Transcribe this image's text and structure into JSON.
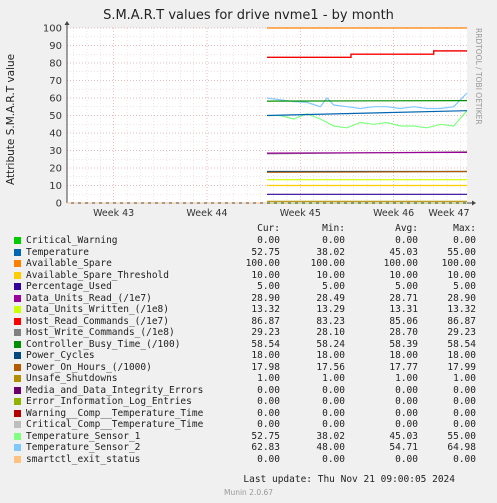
{
  "title": "S.M.A.R.T values for drive nvme1 - by month",
  "vendor_text": "RRDTOOL / TOBI OETIKER",
  "ylabel": "Attribute S.M.A.R.T value",
  "columns": [
    "Cur:",
    "Min:",
    "Avg:",
    "Max:"
  ],
  "last_update": "Last update: Thu Nov 21 09:00:05 2024",
  "munin_version": "Munin 2.0.67",
  "legend": [
    {
      "name": "Critical_Warning",
      "color": "#00cc00",
      "cur": "0.00",
      "min": "0.00",
      "avg": "0.00",
      "max": "0.00"
    },
    {
      "name": "Temperature",
      "color": "#0066b3",
      "cur": "52.75",
      "min": "38.02",
      "avg": "45.03",
      "max": "55.00"
    },
    {
      "name": "Available_Spare",
      "color": "#ff8000",
      "cur": "100.00",
      "min": "100.00",
      "avg": "100.00",
      "max": "100.00"
    },
    {
      "name": "Available_Spare_Threshold",
      "color": "#ffcc00",
      "cur": "10.00",
      "min": "10.00",
      "avg": "10.00",
      "max": "10.00"
    },
    {
      "name": "Percentage_Used",
      "color": "#330099",
      "cur": "5.00",
      "min": "5.00",
      "avg": "5.00",
      "max": "5.00"
    },
    {
      "name": "Data_Units_Read_(/1e7)",
      "color": "#990099",
      "cur": "28.90",
      "min": "28.49",
      "avg": "28.71",
      "max": "28.90"
    },
    {
      "name": "Data_Units_Written_(/1e8)",
      "color": "#ccff00",
      "cur": "13.32",
      "min": "13.29",
      "avg": "13.31",
      "max": "13.32"
    },
    {
      "name": "Host_Read_Commands_(/1e7)",
      "color": "#ff0000",
      "cur": "86.87",
      "min": "83.23",
      "avg": "85.06",
      "max": "86.87"
    },
    {
      "name": "Host_Write_Commands_(/1e8)",
      "color": "#808080",
      "cur": "29.23",
      "min": "28.10",
      "avg": "28.70",
      "max": "29.23"
    },
    {
      "name": "Controller_Busy_Time_(/100)",
      "color": "#008f00",
      "cur": "58.54",
      "min": "58.24",
      "avg": "58.39",
      "max": "58.54"
    },
    {
      "name": "Power_Cycles",
      "color": "#00487d",
      "cur": "18.00",
      "min": "18.00",
      "avg": "18.00",
      "max": "18.00"
    },
    {
      "name": "Power_On_Hours_(/1000)",
      "color": "#b35a00",
      "cur": "17.98",
      "min": "17.56",
      "avg": "17.77",
      "max": "17.99"
    },
    {
      "name": "Unsafe_Shutdowns",
      "color": "#b38f00",
      "cur": "1.00",
      "min": "1.00",
      "avg": "1.00",
      "max": "1.00"
    },
    {
      "name": "Media_and_Data_Integrity_Errors",
      "color": "#6b006b",
      "cur": "0.00",
      "min": "0.00",
      "avg": "0.00",
      "max": "0.00"
    },
    {
      "name": "Error_Information_Log_Entries",
      "color": "#8fb300",
      "cur": "0.00",
      "min": "0.00",
      "avg": "0.00",
      "max": "0.00"
    },
    {
      "name": "Warning__Comp__Temperature_Time",
      "color": "#b30000",
      "cur": "0.00",
      "min": "0.00",
      "avg": "0.00",
      "max": "0.00"
    },
    {
      "name": "Critical_Comp__Temperature_Time",
      "color": "#bebebe",
      "cur": "0.00",
      "min": "0.00",
      "avg": "0.00",
      "max": "0.00"
    },
    {
      "name": "Temperature_Sensor_1",
      "color": "#80ff80",
      "cur": "52.75",
      "min": "38.02",
      "avg": "45.03",
      "max": "55.00"
    },
    {
      "name": "Temperature_Sensor_2",
      "color": "#80c9ff",
      "cur": "62.83",
      "min": "48.00",
      "avg": "54.71",
      "max": "64.98"
    },
    {
      "name": "smartctl_exit_status",
      "color": "#ffc080",
      "cur": "0.00",
      "min": "0.00",
      "avg": "0.00",
      "max": "0.00"
    }
  ],
  "chart_data": {
    "type": "line",
    "title": "S.M.A.R.T values for drive nvme1 - by month",
    "ylabel": "Attribute S.M.A.R.T value",
    "ylim": [
      0,
      100
    ],
    "yticks": [
      0,
      10,
      20,
      30,
      40,
      50,
      60,
      70,
      80,
      90,
      100
    ],
    "xlim": [
      0,
      30
    ],
    "xticks": [
      {
        "label": "Week 43",
        "x": 3.5
      },
      {
        "label": "Week 44",
        "x": 10.5
      },
      {
        "label": "Week 45",
        "x": 17.5
      },
      {
        "label": "Week 46",
        "x": 24.5
      },
      {
        "label": "Week 47",
        "x": 31.5
      }
    ],
    "data_start": 15,
    "grid": true,
    "series": [
      {
        "name": "Available_Spare",
        "color": "#ff8000",
        "points": [
          [
            15,
            100
          ],
          [
            30,
            100
          ]
        ]
      },
      {
        "name": "Host_Read_Commands_(/1e7)",
        "color": "#b30000",
        "points": [
          [
            15,
            83.2
          ],
          [
            21.3,
            83.2
          ],
          [
            21.3,
            85.1
          ],
          [
            24.6,
            85.1
          ],
          [
            24.6,
            85.1
          ],
          [
            27.5,
            85.1
          ],
          [
            27.5,
            86.9
          ],
          [
            30,
            86.9
          ]
        ]
      },
      {
        "name": "Host_Read_Commands_(/1e7) upper",
        "color": "#ff0000",
        "points": [
          [
            15,
            83.23
          ],
          [
            21.3,
            83.23
          ],
          [
            21.3,
            85.06
          ],
          [
            27.5,
            85.06
          ],
          [
            27.5,
            86.87
          ],
          [
            30,
            86.87
          ]
        ]
      },
      {
        "name": "Temperature_Sensor_2",
        "color": "#80c9ff",
        "points": [
          [
            15,
            60
          ],
          [
            16,
            59
          ],
          [
            17,
            58
          ],
          [
            18,
            57.5
          ],
          [
            19,
            55
          ],
          [
            19.5,
            60
          ],
          [
            20,
            56
          ],
          [
            21,
            55
          ],
          [
            22,
            54
          ],
          [
            23,
            55
          ],
          [
            24,
            55
          ],
          [
            25,
            54
          ],
          [
            26,
            55
          ],
          [
            27,
            54
          ],
          [
            28,
            54
          ],
          [
            29,
            55
          ],
          [
            30,
            62.8
          ]
        ]
      },
      {
        "name": "Controller_Busy_Time_(/100)",
        "color": "#008f00",
        "points": [
          [
            15,
            58.24
          ],
          [
            30,
            58.54
          ]
        ]
      },
      {
        "name": "Temperature_Sensor_1",
        "color": "#80ff80",
        "points": [
          [
            15,
            50
          ],
          [
            16,
            50
          ],
          [
            17,
            48
          ],
          [
            18,
            51
          ],
          [
            19,
            48
          ],
          [
            20,
            44
          ],
          [
            21,
            43
          ],
          [
            22,
            46
          ],
          [
            23,
            45
          ],
          [
            24,
            46
          ],
          [
            25,
            44
          ],
          [
            26,
            44
          ],
          [
            27,
            43
          ],
          [
            28,
            45
          ],
          [
            29,
            44
          ],
          [
            30,
            52.75
          ]
        ]
      },
      {
        "name": "Temperature",
        "color": "#0066b3",
        "points": [
          [
            15,
            50
          ],
          [
            30,
            52.75
          ]
        ]
      },
      {
        "name": "Host_Write_Commands_(/1e8)",
        "color": "#808080",
        "points": [
          [
            15,
            28.1
          ],
          [
            30,
            29.2
          ]
        ]
      },
      {
        "name": "Data_Units_Read_(/1e7)",
        "color": "#990099",
        "points": [
          [
            15,
            28.49
          ],
          [
            30,
            28.9
          ]
        ]
      },
      {
        "name": "Power_Cycles",
        "color": "#00487d",
        "points": [
          [
            15,
            18
          ],
          [
            30,
            18
          ]
        ]
      },
      {
        "name": "Power_On_Hours_(/1000)",
        "color": "#b35a00",
        "points": [
          [
            15,
            17.56
          ],
          [
            30,
            17.98
          ]
        ]
      },
      {
        "name": "Data_Units_Written_(/1e8)",
        "color": "#ccff00",
        "points": [
          [
            15,
            13.3
          ],
          [
            30,
            13.32
          ]
        ]
      },
      {
        "name": "Available_Spare_Threshold",
        "color": "#ffcc00",
        "points": [
          [
            15,
            10
          ],
          [
            30,
            10
          ]
        ]
      },
      {
        "name": "Percentage_Used",
        "color": "#330099",
        "points": [
          [
            15,
            5
          ],
          [
            30,
            5
          ]
        ]
      },
      {
        "name": "Unsafe_Shutdowns",
        "color": "#b38f00",
        "points": [
          [
            15,
            1
          ],
          [
            30,
            1
          ]
        ]
      },
      {
        "name": "Critical_Warning",
        "color": "#00cc00",
        "points": [
          [
            15,
            0
          ],
          [
            30,
            0
          ]
        ]
      }
    ]
  }
}
